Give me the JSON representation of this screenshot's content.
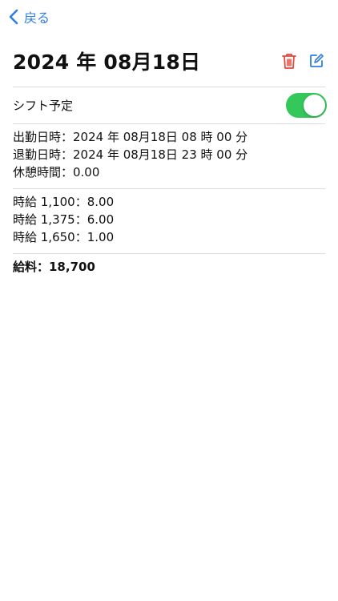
{
  "nav": {
    "back_label": "戻る"
  },
  "header": {
    "title": "2024 年 08月18日"
  },
  "shift": {
    "label": "シフト予定",
    "enabled": true
  },
  "times": [
    "出勤日時：2024 年 08月18日 08 時 00 分",
    "退勤日時：2024 年 08月18日 23 時 00 分",
    "休憩時間：0.00"
  ],
  "wages": [
    "時給 1,100：8.00",
    "時給 1,375：6.00",
    "時給 1,650：1.00"
  ],
  "salary": "給料：18,700",
  "colors": {
    "accent": "#2f7fe0",
    "delete": "#e5483a",
    "toggle_on": "#34c759"
  }
}
